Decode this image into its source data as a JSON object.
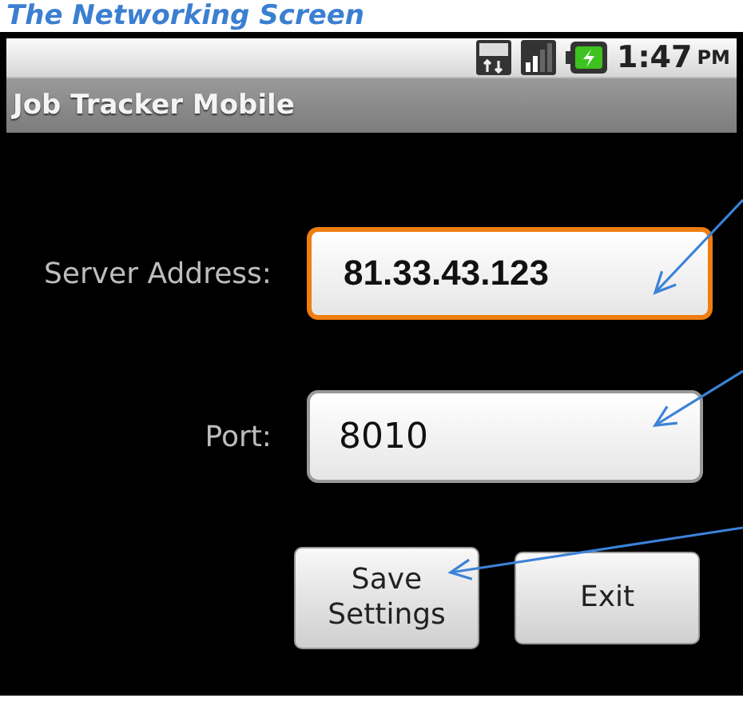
{
  "caption": "The Networking Screen",
  "status_bar": {
    "time": "1:47",
    "meridiem": "PM"
  },
  "app_title": "Job Tracker Mobile",
  "fields": [
    {
      "label": "Server Address:",
      "value": "81.33.43.123",
      "focused": true
    },
    {
      "label": "Port:",
      "value": "8010",
      "focused": false
    }
  ],
  "buttons": [
    "Save Settings",
    "Exit"
  ]
}
